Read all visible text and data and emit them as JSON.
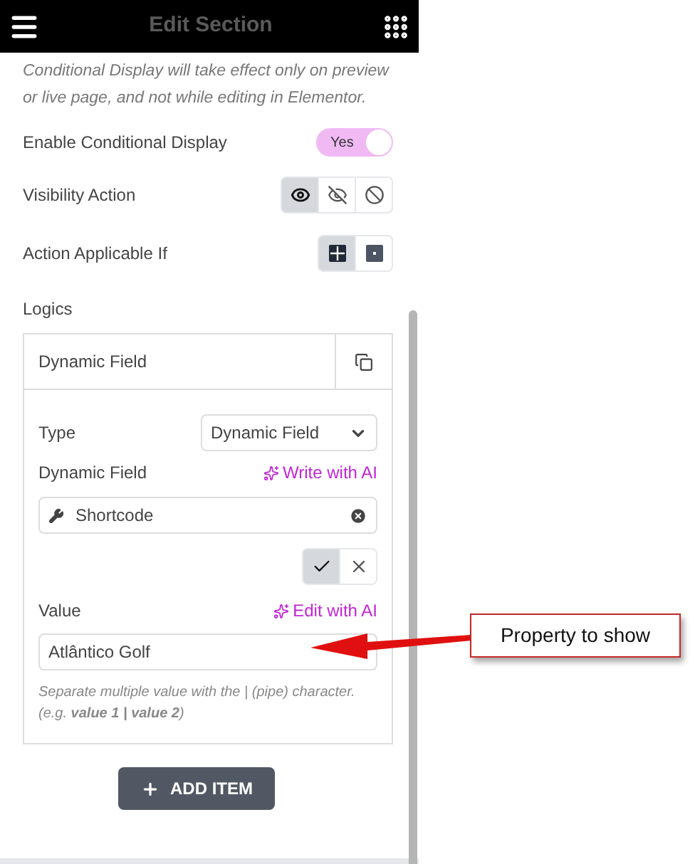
{
  "header": {
    "title": "Edit Section"
  },
  "notice": "Conditional Display will take effect only on preview or live page, and not while editing in Elementor.",
  "enable": {
    "label": "Enable Conditional Display",
    "on": true,
    "toggle_text": "Yes"
  },
  "visibility_action": {
    "label": "Visibility Action",
    "options": [
      {
        "kind": "show",
        "selected": true
      },
      {
        "kind": "hide",
        "selected": false
      },
      {
        "kind": "none",
        "selected": false
      }
    ]
  },
  "action_applicable_if": {
    "label": "Action Applicable If",
    "options": [
      {
        "kind": "all",
        "selected": true
      },
      {
        "kind": "any",
        "selected": false
      }
    ]
  },
  "logics": {
    "label": "Logics",
    "items": [
      {
        "title": "Dynamic Field",
        "type_label": "Type",
        "type_value": "Dynamic Field",
        "dynamic_label": "Dynamic Field",
        "ai_write": "Write with AI",
        "dynamic_value": "Shortcode",
        "confirm": [
          {
            "kind": "apply",
            "selected": true
          },
          {
            "kind": "cancel",
            "selected": false
          }
        ],
        "value_label": "Value",
        "ai_edit": "Edit with AI",
        "value": "Atlântico Golf",
        "help": "Separate multiple value with the | (pipe) character. (e.g. **value 1 | value 2**)"
      }
    ],
    "add_button": "ADD ITEM"
  },
  "callout": {
    "text": "Property to show"
  }
}
